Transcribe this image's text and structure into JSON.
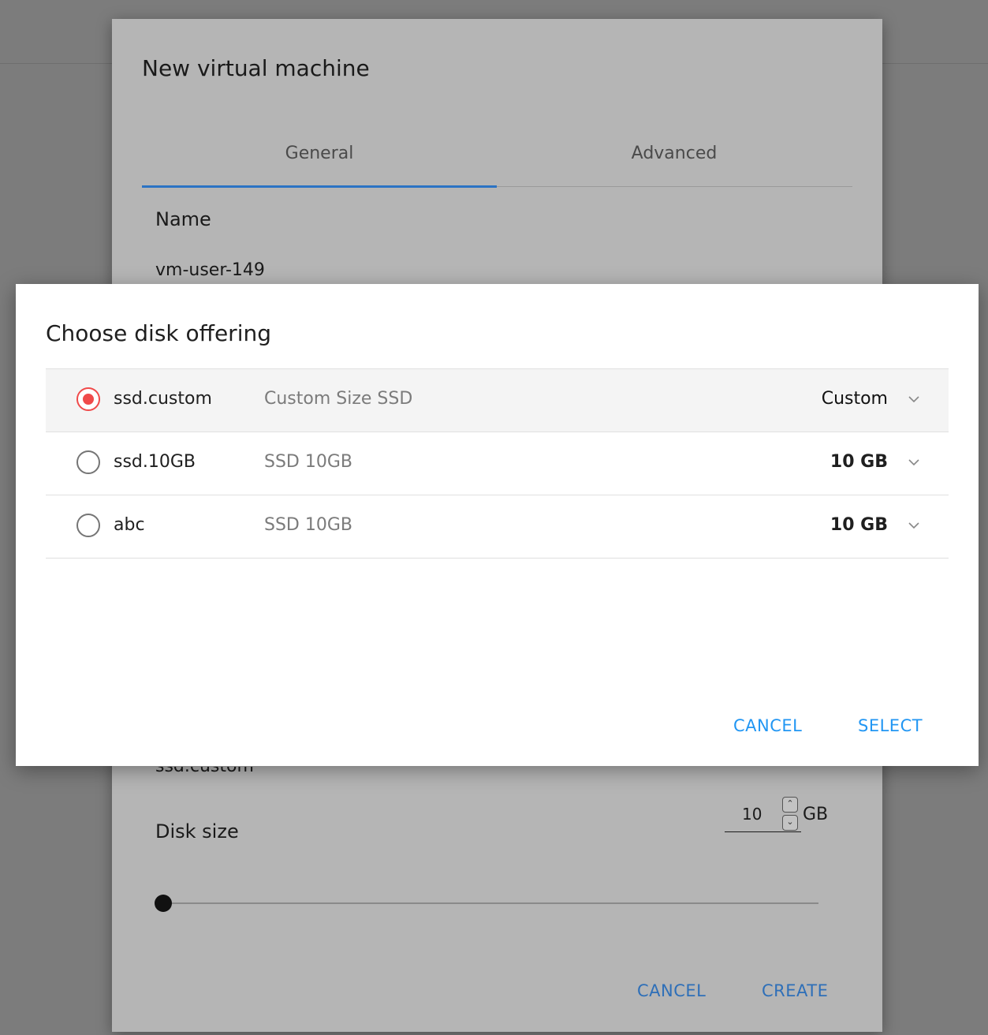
{
  "background_dialog": {
    "title": "New virtual machine",
    "tabs": [
      {
        "label": "General",
        "active": true
      },
      {
        "label": "Advanced",
        "active": false
      }
    ],
    "name_label": "Name",
    "name_value": "vm-user-149",
    "disk_offering_value": "ssd.custom",
    "disk_size_label": "Disk size",
    "disk_size_value": "10",
    "disk_size_unit": "GB",
    "slider_fraction": 0.0,
    "cancel_label": "CANCEL",
    "create_label": "CREATE"
  },
  "disk_offering_dialog": {
    "title": "Choose disk offering",
    "offerings": [
      {
        "name": "ssd.custom",
        "description": "Custom Size SSD",
        "size": "Custom",
        "selected": true
      },
      {
        "name": "ssd.10GB",
        "description": "SSD 10GB",
        "size": "10 GB",
        "selected": false
      },
      {
        "name": "abc",
        "description": "SSD 10GB",
        "size": "10 GB",
        "selected": false
      }
    ],
    "cancel_label": "CANCEL",
    "select_label": "SELECT"
  },
  "colors": {
    "accent_blue": "#2196f3",
    "radio_selected": "#f04a4a",
    "tab_indicator": "#2b73c4"
  },
  "icons": {
    "expand": "chevron-down-icon",
    "spinner_up": "arrow-up-icon",
    "spinner_down": "arrow-down-icon"
  }
}
